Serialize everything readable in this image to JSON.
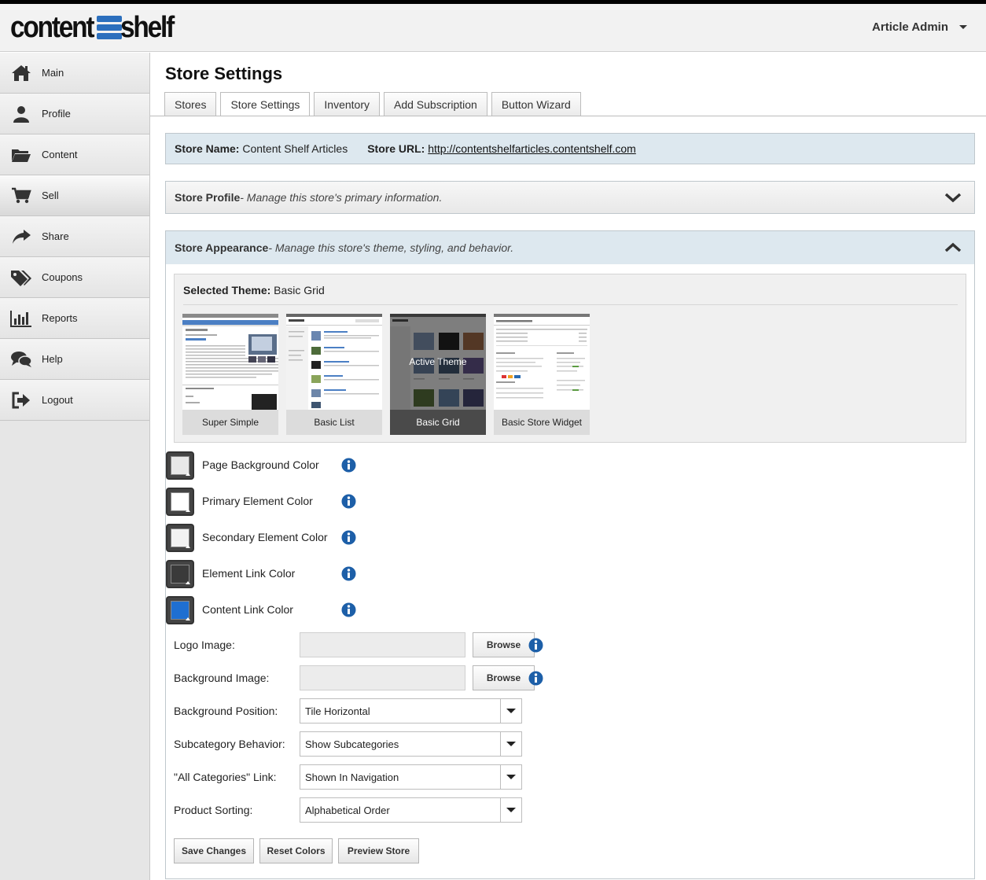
{
  "brand": {
    "logo_left": "content",
    "logo_right": "shelf"
  },
  "header": {
    "user_menu": "Article Admin"
  },
  "sidebar": {
    "items": [
      {
        "label": "Main",
        "icon": "home-icon"
      },
      {
        "label": "Profile",
        "icon": "user-icon"
      },
      {
        "label": "Content",
        "icon": "folder-icon"
      },
      {
        "label": "Sell",
        "icon": "cart-icon"
      },
      {
        "label": "Share",
        "icon": "share-icon"
      },
      {
        "label": "Coupons",
        "icon": "tags-icon"
      },
      {
        "label": "Reports",
        "icon": "bar-chart-icon"
      },
      {
        "label": "Help",
        "icon": "chat-icon"
      },
      {
        "label": "Logout",
        "icon": "logout-icon"
      }
    ],
    "active": "Sell"
  },
  "page": {
    "title": "Store Settings"
  },
  "tabs": [
    {
      "label": "Stores"
    },
    {
      "label": "Store Settings"
    },
    {
      "label": "Inventory"
    },
    {
      "label": "Add Subscription"
    },
    {
      "label": "Button Wizard"
    }
  ],
  "store_info": {
    "name_label": "Store Name:",
    "name_value": "Content Shelf Articles",
    "url_label": "Store URL:",
    "url_value": "http://contentshelfarticles.contentshelf.com"
  },
  "store_profile": {
    "title": "Store Profile",
    "desc": " - Manage this store's primary information."
  },
  "store_appearance": {
    "title": "Store Appearance",
    "desc": " - Manage this store's theme, styling, and behavior.",
    "selected_theme_label": "Selected Theme:",
    "selected_theme_value": "Basic Grid",
    "themes": [
      {
        "name": "Super Simple"
      },
      {
        "name": "Basic List"
      },
      {
        "name": "Basic Grid",
        "overlay": "Active Theme"
      },
      {
        "name": "Basic Store Widget"
      }
    ],
    "colors": [
      {
        "label": "Page Background Color",
        "value": "#e8e8e8"
      },
      {
        "label": "Primary Element Color",
        "value": "#ffffff"
      },
      {
        "label": "Secondary Element Color",
        "value": "#f2f2f2"
      },
      {
        "label": "Element Link Color",
        "value": "#3a3a3a"
      },
      {
        "label": "Content Link Color",
        "value": "#1f6fd1"
      }
    ],
    "logo_image_label": "Logo Image:",
    "background_image_label": "Background Image:",
    "browse_label": "Browse",
    "background_position_label": "Background Position:",
    "background_position_value": "Tile Horizontal",
    "subcategory_behavior_label": "Subcategory Behavior:",
    "subcategory_behavior_value": "Show Subcategories",
    "all_categories_label": "\"All Categories\" Link:",
    "all_categories_value": "Shown In Navigation",
    "product_sorting_label": "Product Sorting:",
    "product_sorting_value": "Alphabetical Order"
  },
  "actions": {
    "save": "Save Changes",
    "reset": "Reset Colors",
    "preview": "Preview Store"
  },
  "colors": {
    "accent": "#2c6fbd",
    "panel_blue": "#dde8ef",
    "info": "#1d5fa8"
  }
}
